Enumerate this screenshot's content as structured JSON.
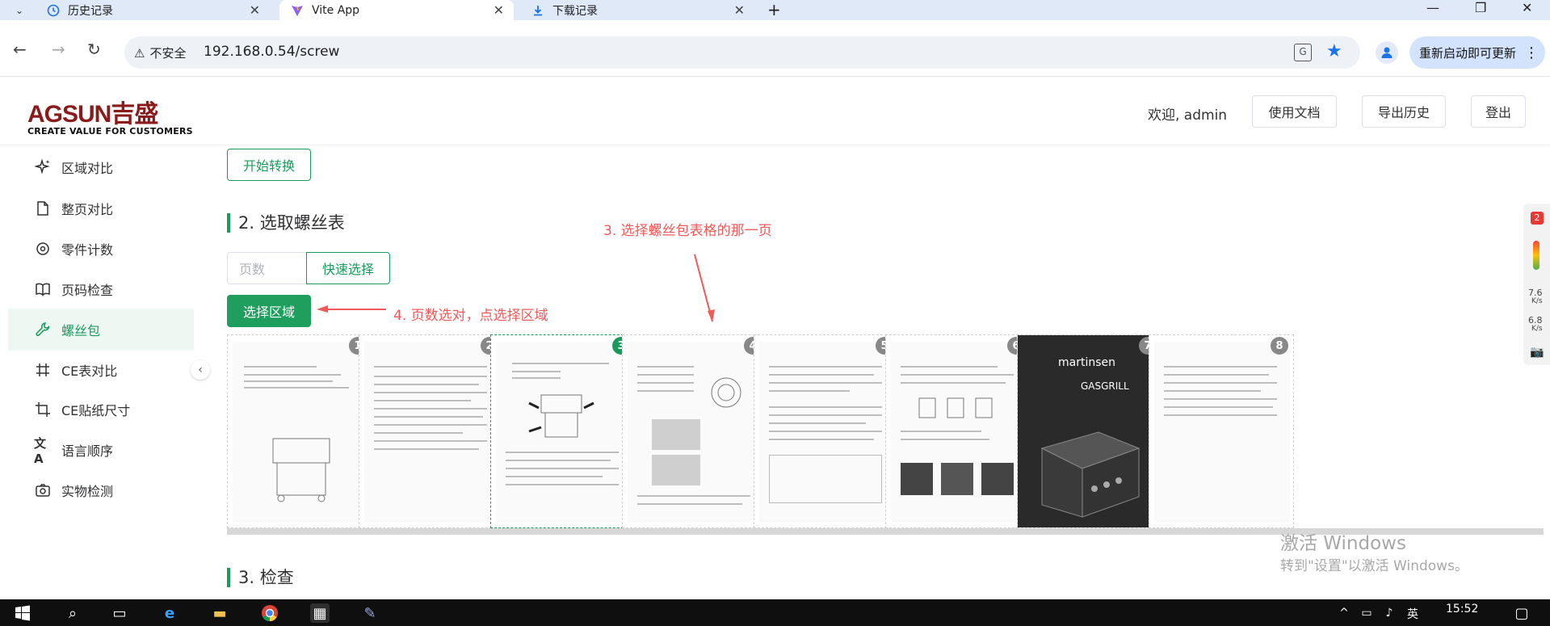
{
  "browser": {
    "tabs": [
      {
        "title": "历史记录",
        "icon": "history-icon"
      },
      {
        "title": "Vite App",
        "icon": "vite-icon"
      },
      {
        "title": "下载记录",
        "icon": "download-icon"
      }
    ],
    "new_tab_label": "+",
    "security_label": "不安全",
    "url": "192.168.0.54/screw",
    "update_button": "重新启动即可更新"
  },
  "header": {
    "logo_brand": "AGSUN吉盛",
    "logo_tagline": "CREATE VALUE FOR CUSTOMERS",
    "welcome": "欢迎, admin",
    "buttons": {
      "docs": "使用文档",
      "export": "导出历史",
      "logout": "登出"
    }
  },
  "sidebar": {
    "items": [
      {
        "label": "区域对比",
        "icon": "sparkle-icon"
      },
      {
        "label": "整页对比",
        "icon": "document-icon"
      },
      {
        "label": "零件计数",
        "icon": "gear-icon"
      },
      {
        "label": "页码检查",
        "icon": "book-icon"
      },
      {
        "label": "螺丝包",
        "icon": "wrench-icon",
        "active": true
      },
      {
        "label": "CE表对比",
        "icon": "grid-icon"
      },
      {
        "label": "CE贴纸尺寸",
        "icon": "crop-icon"
      },
      {
        "label": "语言顺序",
        "icon": "translate-icon"
      },
      {
        "label": "实物检测",
        "icon": "camera-icon"
      }
    ]
  },
  "main": {
    "start_button": "开始转换",
    "section2_title": "2. 选取螺丝表",
    "page_input_placeholder": "页数",
    "quick_select_button": "快速选择",
    "select_area_button": "选择区域",
    "annotation_3": "3. 选择螺丝包表格的那一页",
    "annotation_4": "4. 页数选对，点选择区域",
    "thumbnails": [
      {
        "page": "1",
        "selected": false
      },
      {
        "page": "2",
        "selected": false
      },
      {
        "page": "3",
        "selected": true
      },
      {
        "page": "4",
        "selected": false
      },
      {
        "page": "5",
        "selected": false
      },
      {
        "page": "6",
        "selected": false
      },
      {
        "page": "7",
        "selected": false,
        "cover": true,
        "cover_brand": "martinsen",
        "cover_title": "GASGRILL"
      },
      {
        "page": "8",
        "selected": false
      }
    ],
    "section3_title": "3. 检查"
  },
  "widget": {
    "badge": "2",
    "speed_up": "7.6",
    "speed_down": "6.8",
    "unit": "K/s"
  },
  "watermark": {
    "line1": "激活 Windows",
    "line2": "转到\"设置\"以激活 Windows。"
  },
  "taskbar": {
    "time": "15:52",
    "ime": "英"
  },
  "colors": {
    "accent": "#1a9b5c",
    "annotation": "#f05a5a",
    "logo": "#8b1a1a"
  }
}
